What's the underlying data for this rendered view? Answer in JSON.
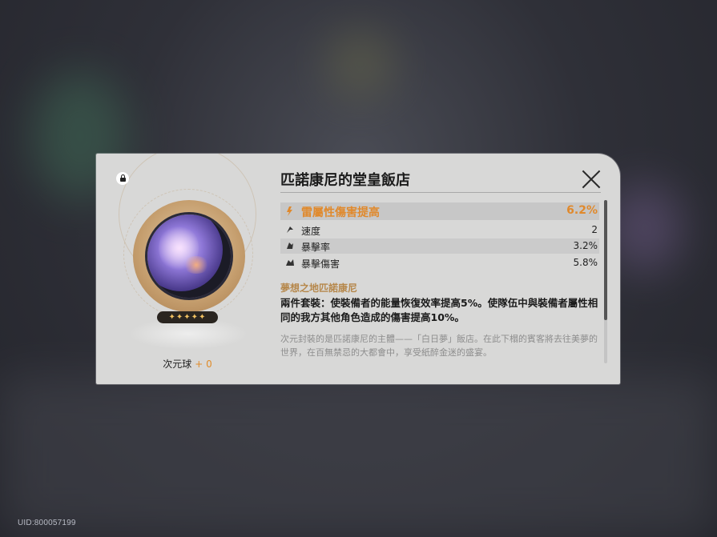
{
  "relic": {
    "name": "匹諾康尼的堂皇飯店",
    "item_type": "次元球",
    "count": "+ 0",
    "stars": "✦✦✦✦✦"
  },
  "main_stat": {
    "label": "雷屬性傷害提高",
    "value": "6.2%",
    "icon": "lightning-damage-icon"
  },
  "sub_stats": [
    {
      "label": "速度",
      "value": "2",
      "icon": "speed-icon"
    },
    {
      "label": "暴擊率",
      "value": "3.2%",
      "icon": "crit-rate-icon"
    },
    {
      "label": "暴擊傷害",
      "value": "5.8%",
      "icon": "crit-damage-icon"
    }
  ],
  "set": {
    "name": "夢想之地匹諾康尼",
    "effect": "兩件套裝：使裝備者的能量恢復效率提高5%。使隊伍中與裝備者屬性相同的我方其他角色造成的傷害提高10%。",
    "lore": "次元封裝的是匹諾康尼的主體——「白日夢」飯店。在此下榻的賓客將去往美夢的世界，在百無禁忌的大都會中，享受紙醉金迷的盛宴。"
  },
  "footer": {
    "uid": "UID:800057199"
  },
  "colors": {
    "accent": "#e0892c",
    "set_name": "#b6884c",
    "panel": "#d8d8d7"
  }
}
